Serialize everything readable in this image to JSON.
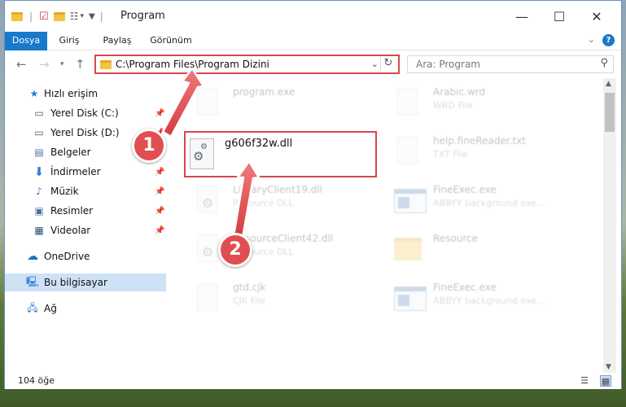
{
  "window": {
    "title": "Program",
    "minimize": "—",
    "maximize": "☐",
    "close": "✕"
  },
  "ribbon": {
    "tabs": [
      "Dosya",
      "Giriş",
      "Paylaş",
      "Görünüm"
    ],
    "help": "?"
  },
  "nav": {
    "address": "C:\\Program Files\\Program Dizini",
    "search_placeholder": "Ara: Program"
  },
  "sidebar": {
    "items": [
      {
        "label": "Hızlı erişim",
        "icon": "star-icon"
      },
      {
        "label": "Yerel Disk (C:)",
        "icon": "drive-icon",
        "pinned": true
      },
      {
        "label": "Yerel Disk (D:)",
        "icon": "drive-icon",
        "pinned": true
      },
      {
        "label": "Belgeler",
        "icon": "documents-icon",
        "pinned": true
      },
      {
        "label": "İndirmeler",
        "icon": "download-icon",
        "pinned": true
      },
      {
        "label": "Müzik",
        "icon": "music-icon",
        "pinned": true
      },
      {
        "label": "Resimler",
        "icon": "pictures-icon",
        "pinned": true
      },
      {
        "label": "Videolar",
        "icon": "videos-icon",
        "pinned": true
      },
      {
        "label": "OneDrive",
        "icon": "cloud-icon"
      },
      {
        "label": "Bu bilgisayar",
        "icon": "computer-icon",
        "selected": true
      },
      {
        "label": "Ağ",
        "icon": "network-icon"
      }
    ]
  },
  "files": {
    "left": [
      {
        "name": "program.exe",
        "desc": ""
      },
      {
        "name": "LibraryClient19.dll",
        "desc": "Resource DLL"
      },
      {
        "name": "ResourceClient42.dll",
        "desc": "Resource DLL"
      },
      {
        "name": "gtd.cjk",
        "desc": "CJK File"
      }
    ],
    "right": [
      {
        "name": "Arabic.wrd",
        "desc": "WRD File"
      },
      {
        "name": "help.fineReader.txt",
        "desc": "TXT File"
      },
      {
        "name": "FineExec.exe",
        "desc": "ABBYY background exe..."
      },
      {
        "name": "Resource",
        "desc": ""
      },
      {
        "name": "FineExec.exe",
        "desc": "ABBYY background exe..."
      }
    ],
    "highlighted": "g606f32w.dll"
  },
  "status": {
    "count": "104 öğe"
  },
  "annotations": {
    "badge1": "1",
    "badge2": "2",
    "color": "#e04e52"
  }
}
